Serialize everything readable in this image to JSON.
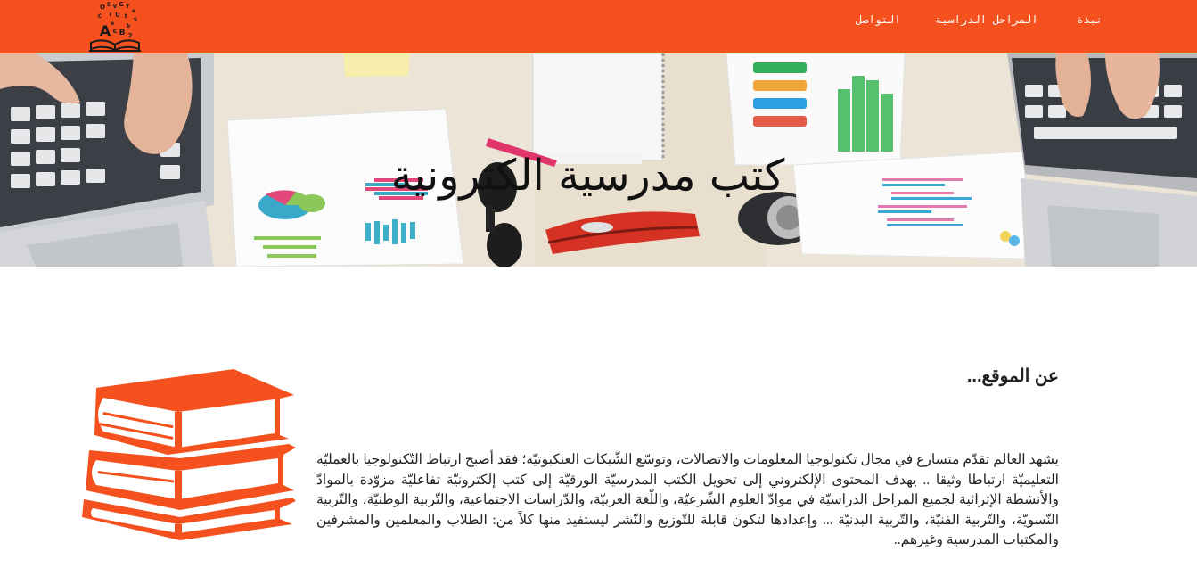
{
  "theme": {
    "accent": "#f4511e",
    "nav_text": "#ffffff"
  },
  "navbar": {
    "logo_icon": "alphabet-book-logo-icon",
    "items": [
      {
        "label": "نبذة"
      },
      {
        "label": "المراحل الدراسية"
      },
      {
        "label": "التواصل"
      }
    ]
  },
  "hero": {
    "title": "كتب مدرسية الكترونية"
  },
  "about": {
    "heading": "عن الموقع...",
    "icon": "stacked-books-icon",
    "text": "يشهد العالم تقدّم متسارع في مجال تكنولوجيا المعلومات والاتصالات، وتوسّع الشّبكات العنكبوتيّة؛ فقد أصبح ارتباط التّكنولوجيا بالعمليّة التعليميّة ارتباطا وثيقا .. يهدف المحتوى الإلكتروني إلى تحويل الكتب المدرسيّة الورقيّة إلى كتب إلكترونيّة تفاعليّة مزوّدة بالموادّ والأنشطة الإثرائية لجميع المراحل الدراسيّة في موادّ العلوم الشّرعيّة، واللّغة العربيّة، والدّراسات الاجتماعية، والتّربية الوطنيّة، والتّربية النّسويّة، والتّربية الفنيّة، والتّربية البدنيّة ... وإعدادها لتكون قابلة للتّوزيع والنّشر ليستفيد منها كلاً من: الطلاب والمعلمين والمشرفين والمكتبات المدرسية وغيرهم.."
  }
}
